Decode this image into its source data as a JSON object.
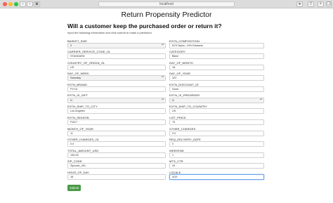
{
  "browser": {
    "url": "localhost"
  },
  "page": {
    "title": "Return Propensity Predictor",
    "subtitle": "Will a customer keep the purchased order or return it?",
    "description": "Input the following information and click submit to make a prediction.",
    "submit_label": "Submit"
  },
  "fields": {
    "basket_size": {
      "label": "BASKET_SIZE",
      "value": "0"
    },
    "extn_composition": {
      "label": "EXTN_COMPOSITION",
      "value": "81% Nylon, 19% Elastane"
    },
    "carrier_service_code_ol": {
      "label": "CARRIER_SERVICE_CODE_OL",
      "value": "STANDARD"
    },
    "category": {
      "label": "CATEGORY",
      "value": "Bikini"
    },
    "country_of_origin_ol": {
      "label": "COUNTRY_OF_ORIGIN_OL",
      "value": "US"
    },
    "day_of_month": {
      "label": "DAY_OF_MONTH",
      "value": "18"
    },
    "day_of_week": {
      "label": "DAY_OF_WEEK",
      "value": "Saturday"
    },
    "day_of_year": {
      "label": "DAY_OF_YEAR",
      "value": "322"
    },
    "extn_brand": {
      "label": "EXTN_BRAND",
      "value": "PYCA"
    },
    "extn_discount_id": {
      "label": "EXTN_DISCOUNT_ID",
      "value": "None"
    },
    "extn_is_gift": {
      "label": "EXTN_IS_GIFT",
      "value": "N"
    },
    "extn_is_preorder": {
      "label": "EXTN_IS_PREORDER",
      "value": "N"
    },
    "extn_ship_to_city": {
      "label": "EXTN_SHIP_TO_CITY",
      "value": "Los Angeles"
    },
    "extn_ship_to_country": {
      "label": "EXTN_SHIP_TO_COUNTRY",
      "value": "US"
    },
    "extn_season": {
      "label": "EXTN_SEASON",
      "value": "FW17"
    },
    "list_price": {
      "label": "LIST_PRICE",
      "value": "75"
    },
    "month_of_year": {
      "label": "MONTH_OF_YEAR",
      "value": "11"
    },
    "other_charges": {
      "label": "OTHER_CHARGES",
      "value": "0.0"
    },
    "other_charges_ol": {
      "label": "OTHER_CHARGES_OL",
      "value": "0.0"
    },
    "req_delivery_date": {
      "label": "REQ_DELIVERY_DATE",
      "value": "0"
    },
    "total_amount_usd": {
      "label": "TOTAL_AMOUNT_USD",
      "value": "195.05"
    },
    "weekend": {
      "label": "WEEKEND",
      "value": "1"
    },
    "zip_code": {
      "label": "ZIP_CODE",
      "value": "Zipcode_401"
    },
    "mts_ctr": {
      "label": "MTS_CTR",
      "value": "34"
    },
    "hour_of_day": {
      "label": "HOUR_OF_DAY",
      "value": "18"
    },
    "locale": {
      "label": "LOCALE",
      "value": "of19"
    }
  }
}
